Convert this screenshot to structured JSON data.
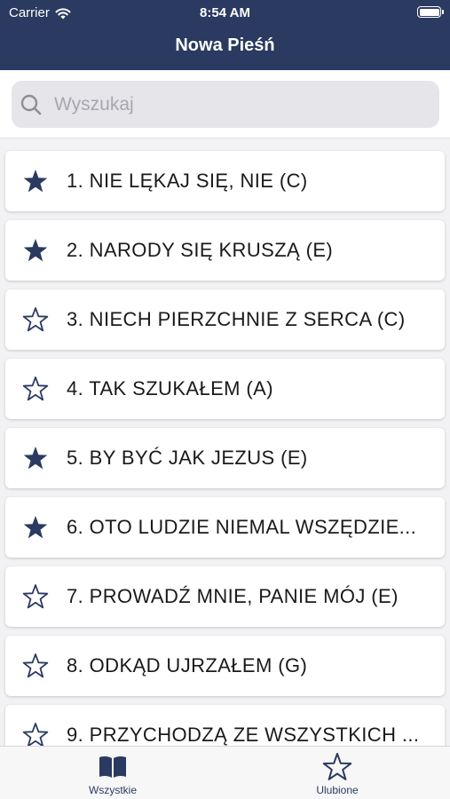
{
  "status_bar": {
    "carrier": "Carrier",
    "time": "8:54 AM"
  },
  "header": {
    "title": "Nowa Pieśń"
  },
  "search": {
    "placeholder": "Wyszukaj"
  },
  "songs": [
    {
      "title": "1. NIE LĘKAJ SIĘ, NIE (C)",
      "favorite": true
    },
    {
      "title": "2. NARODY SIĘ KRUSZĄ (E)",
      "favorite": true
    },
    {
      "title": "3. NIECH PIERZCHNIE Z SERCA (C)",
      "favorite": false
    },
    {
      "title": "4. TAK SZUKAŁEM (A)",
      "favorite": false
    },
    {
      "title": "5. BY BYĆ JAK JEZUS (E)",
      "favorite": true
    },
    {
      "title": "6. OTO LUDZIE NIEMAL WSZĘDZIE...",
      "favorite": true
    },
    {
      "title": "7. PROWADŹ MNIE, PANIE MÓJ (E)",
      "favorite": false
    },
    {
      "title": "8. ODKĄD UJRZAŁEM (G)",
      "favorite": false
    },
    {
      "title": "9. PRZYCHODZĄ ZE WSZYSTKICH ...",
      "favorite": false
    }
  ],
  "tabs": [
    {
      "label": "Wszystkie",
      "icon": "book-icon"
    },
    {
      "label": "Ulubione",
      "icon": "star-icon"
    }
  ],
  "colors": {
    "brand": "#2a3a60",
    "background": "#f2f2f4"
  }
}
